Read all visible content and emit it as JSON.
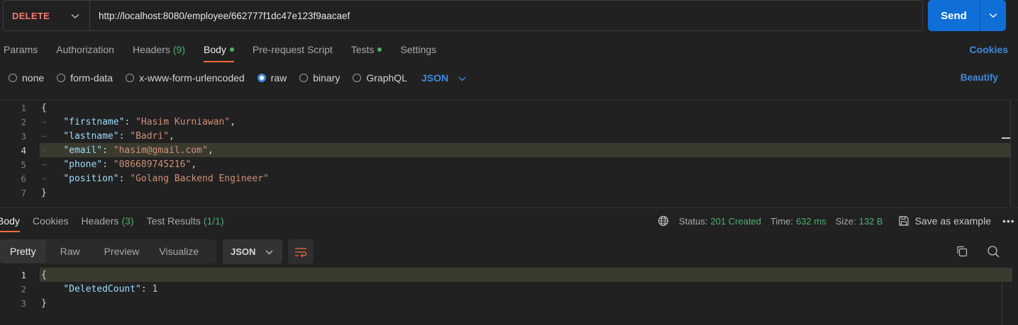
{
  "request": {
    "method": "DELETE",
    "url": "http://localhost:8080/employee/662777f1dc47e123f9aacaef",
    "send_label": "Send"
  },
  "request_tabs": [
    {
      "label": "Params"
    },
    {
      "label": "Authorization"
    },
    {
      "label": "Headers",
      "count": "(9)"
    },
    {
      "label": "Body",
      "active": true,
      "dot": true
    },
    {
      "label": "Pre-request Script"
    },
    {
      "label": "Tests",
      "dot": true
    },
    {
      "label": "Settings"
    }
  ],
  "cookies_label": "Cookies",
  "body_types": [
    "none",
    "form-data",
    "x-www-form-urlencoded",
    "raw",
    "binary",
    "GraphQL"
  ],
  "body_type_selected": "raw",
  "body_language": "JSON",
  "beautify_label": "Beautify",
  "request_body_lines": [
    {
      "n": "1",
      "text": "{"
    },
    {
      "n": "2",
      "key": "\"firstname\"",
      "value": "\"Hasim Kurniawan\""
    },
    {
      "n": "3",
      "key": "\"lastname\"",
      "value": "\"Badri\""
    },
    {
      "n": "4",
      "key": "\"email\"",
      "value": "\"hasim@gmail.com\""
    },
    {
      "n": "5",
      "key": "\"phone\"",
      "value": "\"086689745216\""
    },
    {
      "n": "6",
      "key": "\"position\"",
      "value": "\"Golang Backend Engineer\""
    },
    {
      "n": "7",
      "text": "}"
    }
  ],
  "response_tabs": [
    {
      "label": "Body",
      "active": true
    },
    {
      "label": "Cookies"
    },
    {
      "label": "Headers",
      "count": "(3)"
    },
    {
      "label": "Test Results",
      "count": "(1/1)"
    }
  ],
  "status": {
    "status_label": "Status:",
    "status_value": "201 Created",
    "time_label": "Time:",
    "time_value": "632 ms",
    "size_label": "Size:",
    "size_value": "132 B",
    "save_label": "Save as example",
    "more": "•••"
  },
  "view_modes": [
    "Pretty",
    "Raw",
    "Preview",
    "Visualize"
  ],
  "view_mode_selected": "Pretty",
  "response_format": "JSON",
  "response_body_lines": [
    {
      "n": "1",
      "text": "{"
    },
    {
      "n": "2",
      "key": "\"DeletedCount\"",
      "number": "1"
    },
    {
      "n": "3",
      "text": "}"
    }
  ],
  "colors": {
    "accent_orange": "#f26b3a",
    "link_blue": "#3f8ae0",
    "send_blue": "#0f6fd6",
    "success_green": "#4caf6f",
    "method_delete": "#f47b6a"
  },
  "icons": [
    "chevron-down-icon",
    "globe-icon",
    "save-icon",
    "wrap-lines-icon",
    "copy-icon",
    "search-icon"
  ]
}
